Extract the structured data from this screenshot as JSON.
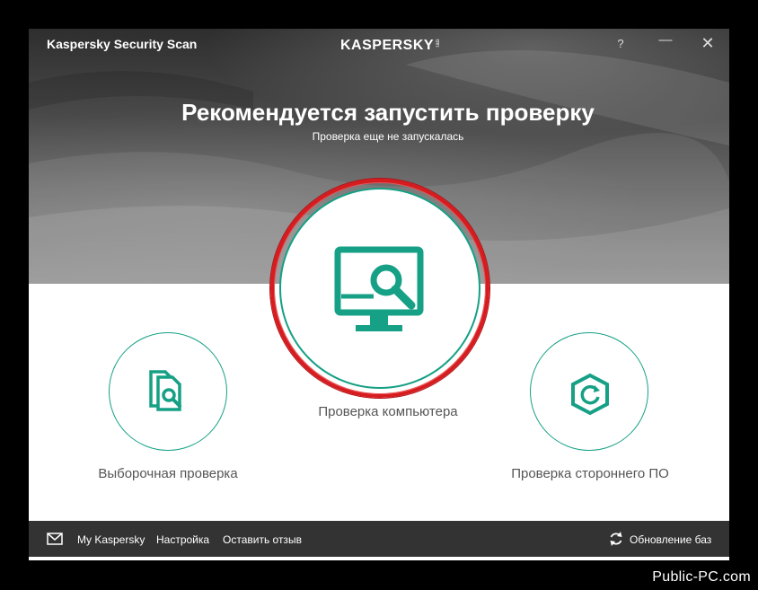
{
  "window": {
    "app_title": "Kaspersky Security Scan",
    "logo_text": "KASPERSKY",
    "logo_lab": "lab",
    "help_label": "?",
    "minimize_label": "—",
    "close_label": "✕"
  },
  "hero": {
    "headline": "Рекомендуется запустить проверку",
    "subline": "Проверка еще не запускалась"
  },
  "actions": {
    "full_scan_label": "Проверка компьютера",
    "custom_scan_label": "Выборочная проверка",
    "third_party_label": "Проверка стороннего ПО"
  },
  "footer": {
    "my_kaspersky": "My Kaspersky",
    "settings": "Настройка",
    "feedback": "Оставить отзыв",
    "update": "Обновление баз"
  },
  "watermark": "Public-PC.com",
  "icons": {
    "monitor": "monitor-search-icon",
    "documents": "documents-search-icon",
    "hexagon": "hexagon-refresh-icon",
    "mail": "mail-icon",
    "refresh": "refresh-icon"
  },
  "colors": {
    "accent_green": "#16a085",
    "highlight_red": "#d71c20",
    "footer_bg": "#333333"
  }
}
